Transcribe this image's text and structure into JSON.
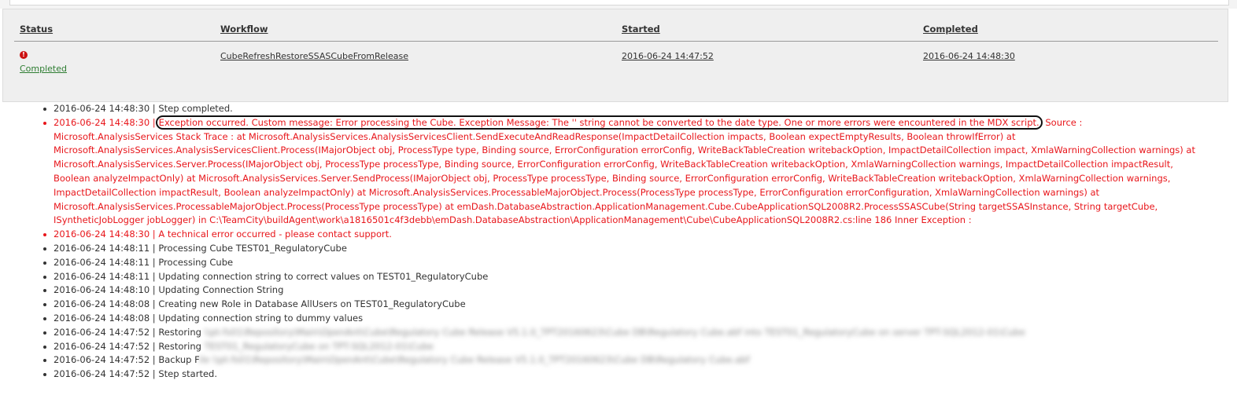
{
  "workflow_table": {
    "headers": {
      "status": "Status",
      "workflow": "Workflow",
      "started": "Started",
      "completed": "Completed"
    },
    "row": {
      "status_icon": "error-icon",
      "status": "Completed",
      "workflow": "CubeRefreshRestoreSSASCubeFromRelease",
      "started": "2016-06-24 14:47:52",
      "completed": "2016-06-24 14:48:30"
    }
  },
  "log": {
    "entries": [
      {
        "time": "2016-06-24 14:48:30",
        "text": "Step completed."
      },
      {
        "time": "2016-06-24 14:48:30",
        "highlight": "Exception occurred. Custom message: Error processing the Cube. Exception Message: The '' string cannot be converted to the date type. One or more errors were encountered in the MDX script.",
        "text": "Source : Microsoft.AnalysisServices Stack Trace : at Microsoft.AnalysisServices.AnalysisServicesClient.SendExecuteAndReadResponse(ImpactDetailCollection impacts, Boolean expectEmptyResults, Boolean throwIfError) at Microsoft.AnalysisServices.AnalysisServicesClient.Process(IMajorObject obj, ProcessType type, Binding source, ErrorConfiguration errorConfig, WriteBackTableCreation writebackOption, ImpactDetailCollection impact, XmlaWarningCollection warnings) at Microsoft.AnalysisServices.Server.Process(IMajorObject obj, ProcessType processType, Binding source, ErrorConfiguration errorConfig, WriteBackTableCreation writebackOption, XmlaWarningCollection warnings, ImpactDetailCollection impactResult, Boolean analyzeImpactOnly) at Microsoft.AnalysisServices.Server.SendProcess(IMajorObject obj, ProcessType processType, Binding source, ErrorConfiguration errorConfig, WriteBackTableCreation writebackOption, XmlaWarningCollection warnings, ImpactDetailCollection impactResult, Boolean analyzeImpactOnly) at Microsoft.AnalysisServices.ProcessableMajorObject.Process(ProcessType processType, ErrorConfiguration errorConfiguration, XmlaWarningCollection warnings) at Microsoft.AnalysisServices.ProcessableMajorObject.Process(ProcessType processType) at emDash.DatabaseAbstraction.ApplicationManagement.Cube.CubeApplicationSQL2008R2.ProcessSSASCube(String targetSSASInstance, String targetCube, ISyntheticJobLogger jobLogger) in C:\\TeamCity\\buildAgent\\work\\a1816501c4f3debb\\emDash.DatabaseAbstraction\\ApplicationManagement\\Cube\\CubeApplicationSQL2008R2.cs:line 186 Inner Exception :"
      },
      {
        "time": "2016-06-24 14:48:30",
        "text": "A technical error occurred - please contact support."
      },
      {
        "time": "2016-06-24 14:48:11",
        "text": "Processing Cube TEST01_RegulatoryCube"
      },
      {
        "time": "2016-06-24 14:48:11",
        "text": "Processing Cube"
      },
      {
        "time": "2016-06-24 14:48:11",
        "text": "Updating connection string to correct values on TEST01_RegulatoryCube"
      },
      {
        "time": "2016-06-24 14:48:10",
        "text": "Updating Connection String"
      },
      {
        "time": "2016-06-24 14:48:08",
        "text": "Creating new Role in Database AllUsers on TEST01_RegulatoryCube"
      },
      {
        "time": "2016-06-24 14:48:08",
        "text": "Updating connection string to dummy values"
      },
      {
        "time": "2016-06-24 14:47:52",
        "text": "Restoring",
        "blurred": "\\\\pt-fs01\\Repository\\Main\\OpenAnt\\Cube\\Regulatory Cube Release V5.1.0_TPT20160623\\Cube DB\\Regulatory Cube.abf into TEST01_RegulatoryCube on server TPT-SQL2012-01\\Cube"
      },
      {
        "time": "2016-06-24 14:47:52",
        "text": "Restoring",
        "blurred": "TEST01_RegulatoryCube on TPT-SQL2012-01\\Cube"
      },
      {
        "time": "2016-06-24 14:47:52",
        "text": "Backup F",
        "blurred": "ile \\\\pt-fs01\\Repository\\Main\\OpenAnt\\Cube\\Regulatory Cube Release V5.1.0_TPT20160623\\Cube DB\\Regulatory Cube.abf"
      },
      {
        "time": "2016-06-24 14:47:52",
        "text": "Step started."
      }
    ]
  }
}
